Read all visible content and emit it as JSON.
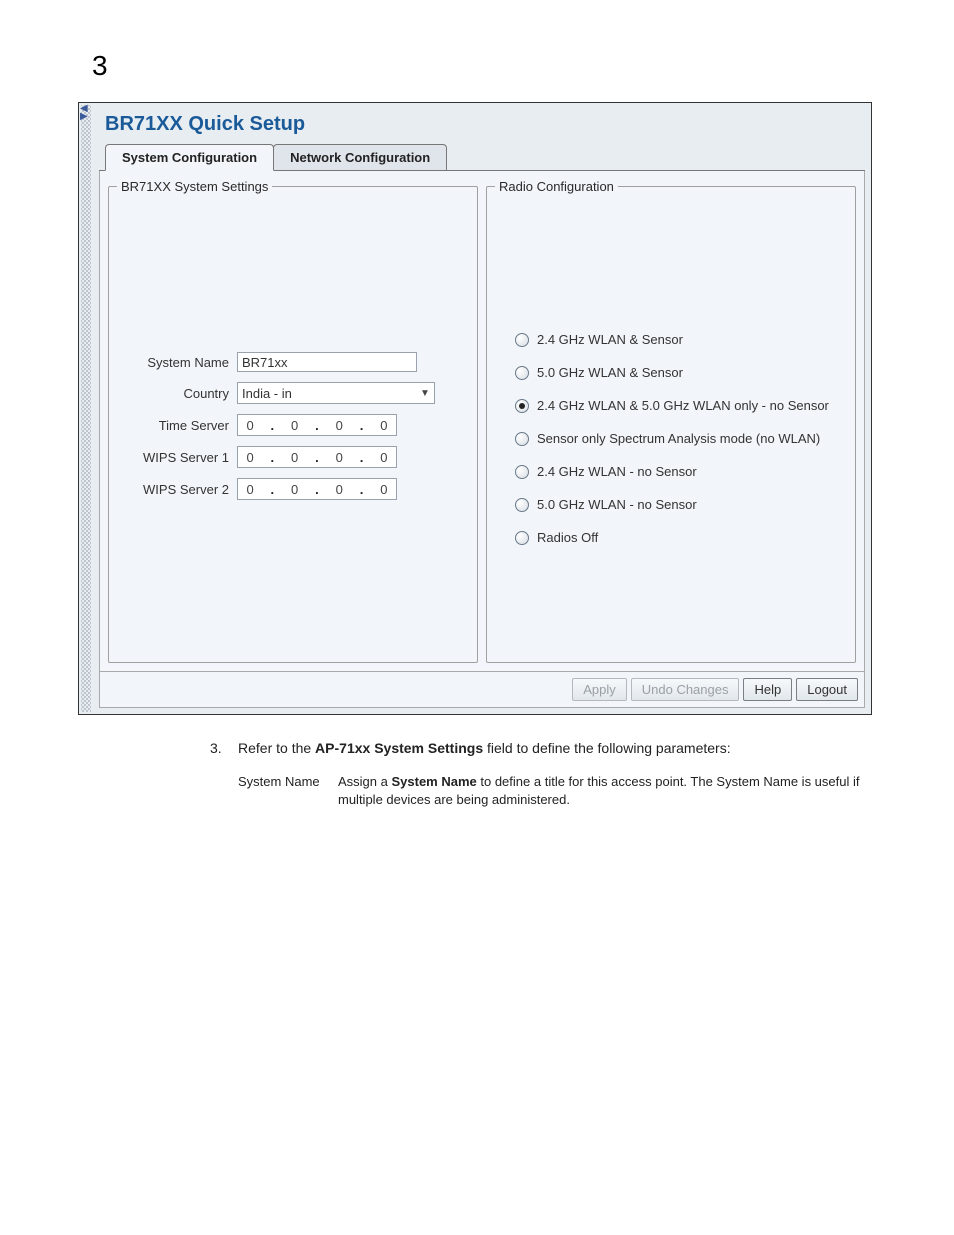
{
  "page_number": "3",
  "title": "BR71XX Quick Setup",
  "tabs": [
    {
      "label": "System Configuration",
      "active": true
    },
    {
      "label": "Network Configuration",
      "active": false
    }
  ],
  "system_settings": {
    "legend": "BR71XX System Settings",
    "system_name": {
      "label": "System Name",
      "value": "BR71xx"
    },
    "country": {
      "label": "Country",
      "value": "India - in"
    },
    "time_server": {
      "label": "Time Server",
      "ip": [
        "0",
        "0",
        "0",
        "0"
      ]
    },
    "wips1": {
      "label": "WIPS Server 1",
      "ip": [
        "0",
        "0",
        "0",
        "0"
      ]
    },
    "wips2": {
      "label": "WIPS Server 2",
      "ip": [
        "0",
        "0",
        "0",
        "0"
      ]
    }
  },
  "radio_config": {
    "legend": "Radio Configuration",
    "options": [
      {
        "label": "2.4 GHz WLAN & Sensor"
      },
      {
        "label": "5.0 GHz WLAN & Sensor"
      },
      {
        "label": "2.4 GHz WLAN & 5.0 GHz WLAN only - no Sensor"
      },
      {
        "label": "Sensor only Spectrum Analysis mode (no WLAN)"
      },
      {
        "label": "2.4 GHz WLAN - no Sensor"
      },
      {
        "label": "5.0 GHz WLAN - no Sensor"
      },
      {
        "label": "Radios Off"
      }
    ],
    "selected_index": 2
  },
  "buttons": {
    "apply": "Apply",
    "undo": "Undo Changes",
    "help": "Help",
    "logout": "Logout"
  },
  "doc": {
    "step_num": "3.",
    "step_prefix": "Refer to the ",
    "step_bold": "AP-71xx System Settings",
    "step_suffix": " field to define the following parameters:",
    "row_label": "System Name",
    "row_prefix": "Assign a ",
    "row_bold": "System Name",
    "row_suffix": " to define a title for this access point. The System Name is useful if multiple devices are being administered."
  }
}
